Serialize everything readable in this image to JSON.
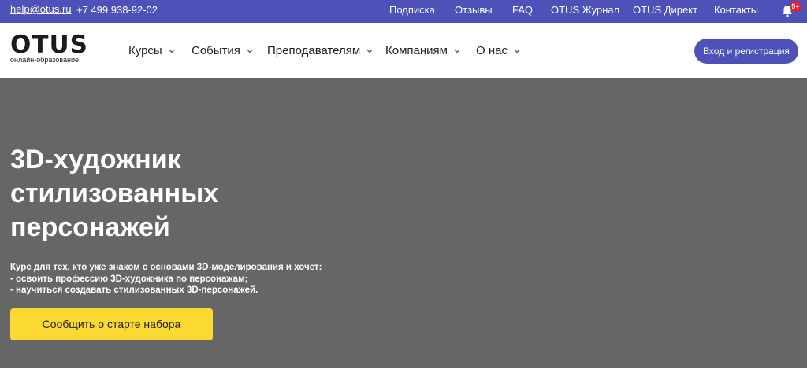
{
  "topbar": {
    "email": "help@otus.ru",
    "phone": "+7 499 938-92-02",
    "links": [
      "Подписка",
      "Отзывы",
      "FAQ",
      "OTUS Журнал",
      "OTUS Директ",
      "Контакты"
    ],
    "notifications_badge": "9+"
  },
  "header": {
    "logo_word": "OTUS",
    "logo_sub": "онлайн-образование",
    "nav": [
      "Курсы",
      "События",
      "Преподавателям",
      "Компаниям",
      "О нас"
    ],
    "login_label": "Вход и регистрация"
  },
  "hero": {
    "title_lines": [
      "3D-художник",
      "стилизованных",
      "персонажей"
    ],
    "description_lines": [
      "Курс для тех, кто уже знаком с основами 3D-моделирования и хочет:",
      "- освоить профессию 3D-художника по персонажам;",
      "- научиться создавать стилизованных 3D-персонажей."
    ],
    "cta_label": "Сообщить о старте набора"
  },
  "colors": {
    "brand": "#4e52b8",
    "hero_bg": "#666666",
    "cta": "#fcd832",
    "badge": "#e0202f"
  }
}
